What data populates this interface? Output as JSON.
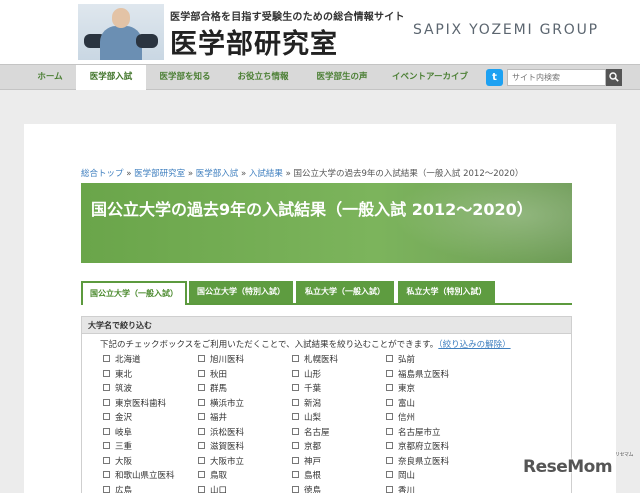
{
  "header": {
    "tagline": "医学部合格を目指す受験生のための総合情報サイト",
    "site_title": "医学部研究室",
    "group_logo": "SAPIX YOZEMI GROUP"
  },
  "nav": {
    "items": [
      {
        "label": "ホーム",
        "active": false
      },
      {
        "label": "医学部入試",
        "active": true
      },
      {
        "label": "医学部を知る",
        "active": false
      },
      {
        "label": "お役立ち情報",
        "active": false
      },
      {
        "label": "医学部生の声",
        "active": false
      },
      {
        "label": "イベントアーカイブ",
        "active": false
      }
    ],
    "twitter_icon": "twitter-icon",
    "search_placeholder": "サイト内検索",
    "search_icon": "magnifier-icon"
  },
  "breadcrumb": {
    "links": [
      "総合トップ",
      "医学部研究室",
      "医学部入試",
      "入試結果"
    ],
    "separator": "»",
    "current": "国公立大学の過去9年の入試結果（一般入試 2012～2020）"
  },
  "page_title": "国公立大学の過去9年の入試結果（一般入試 2012～2020）",
  "tabs": [
    {
      "label": "国公立大学（一般入試）",
      "active": true
    },
    {
      "label": "国公立大学（特別入試）",
      "active": false
    },
    {
      "label": "私立大学（一般入試）",
      "active": false
    },
    {
      "label": "私立大学（特別入試）",
      "active": false
    }
  ],
  "filter": {
    "heading": "大学名で絞り込む",
    "description": "下記のチェックボックスをご利用いただくことで、入試結果を絞り込むことができます。",
    "reset_label": "（絞り込みの解除）",
    "universities": [
      [
        "北海道",
        "旭川医科",
        "札幌医科",
        "弘前"
      ],
      [
        "東北",
        "秋田",
        "山形",
        "福島県立医科"
      ],
      [
        "筑波",
        "群馬",
        "千葉",
        "東京"
      ],
      [
        "東京医科歯科",
        "横浜市立",
        "新潟",
        "富山"
      ],
      [
        "金沢",
        "福井",
        "山梨",
        "信州"
      ],
      [
        "岐阜",
        "浜松医科",
        "名古屋",
        "名古屋市立"
      ],
      [
        "三重",
        "滋賀医科",
        "京都",
        "京都府立医科"
      ],
      [
        "大阪",
        "大阪市立",
        "神戸",
        "奈良県立医科"
      ],
      [
        "和歌山県立医科",
        "鳥取",
        "島根",
        "岡山"
      ],
      [
        "広島",
        "山口",
        "徳島",
        "香川"
      ]
    ]
  },
  "watermark": {
    "text": "ReseMom",
    "sub": "リセマム"
  },
  "colors": {
    "accent_green": "#5e9c40",
    "nav_text": "#4b7f34",
    "link_blue": "#3f7fbf"
  }
}
